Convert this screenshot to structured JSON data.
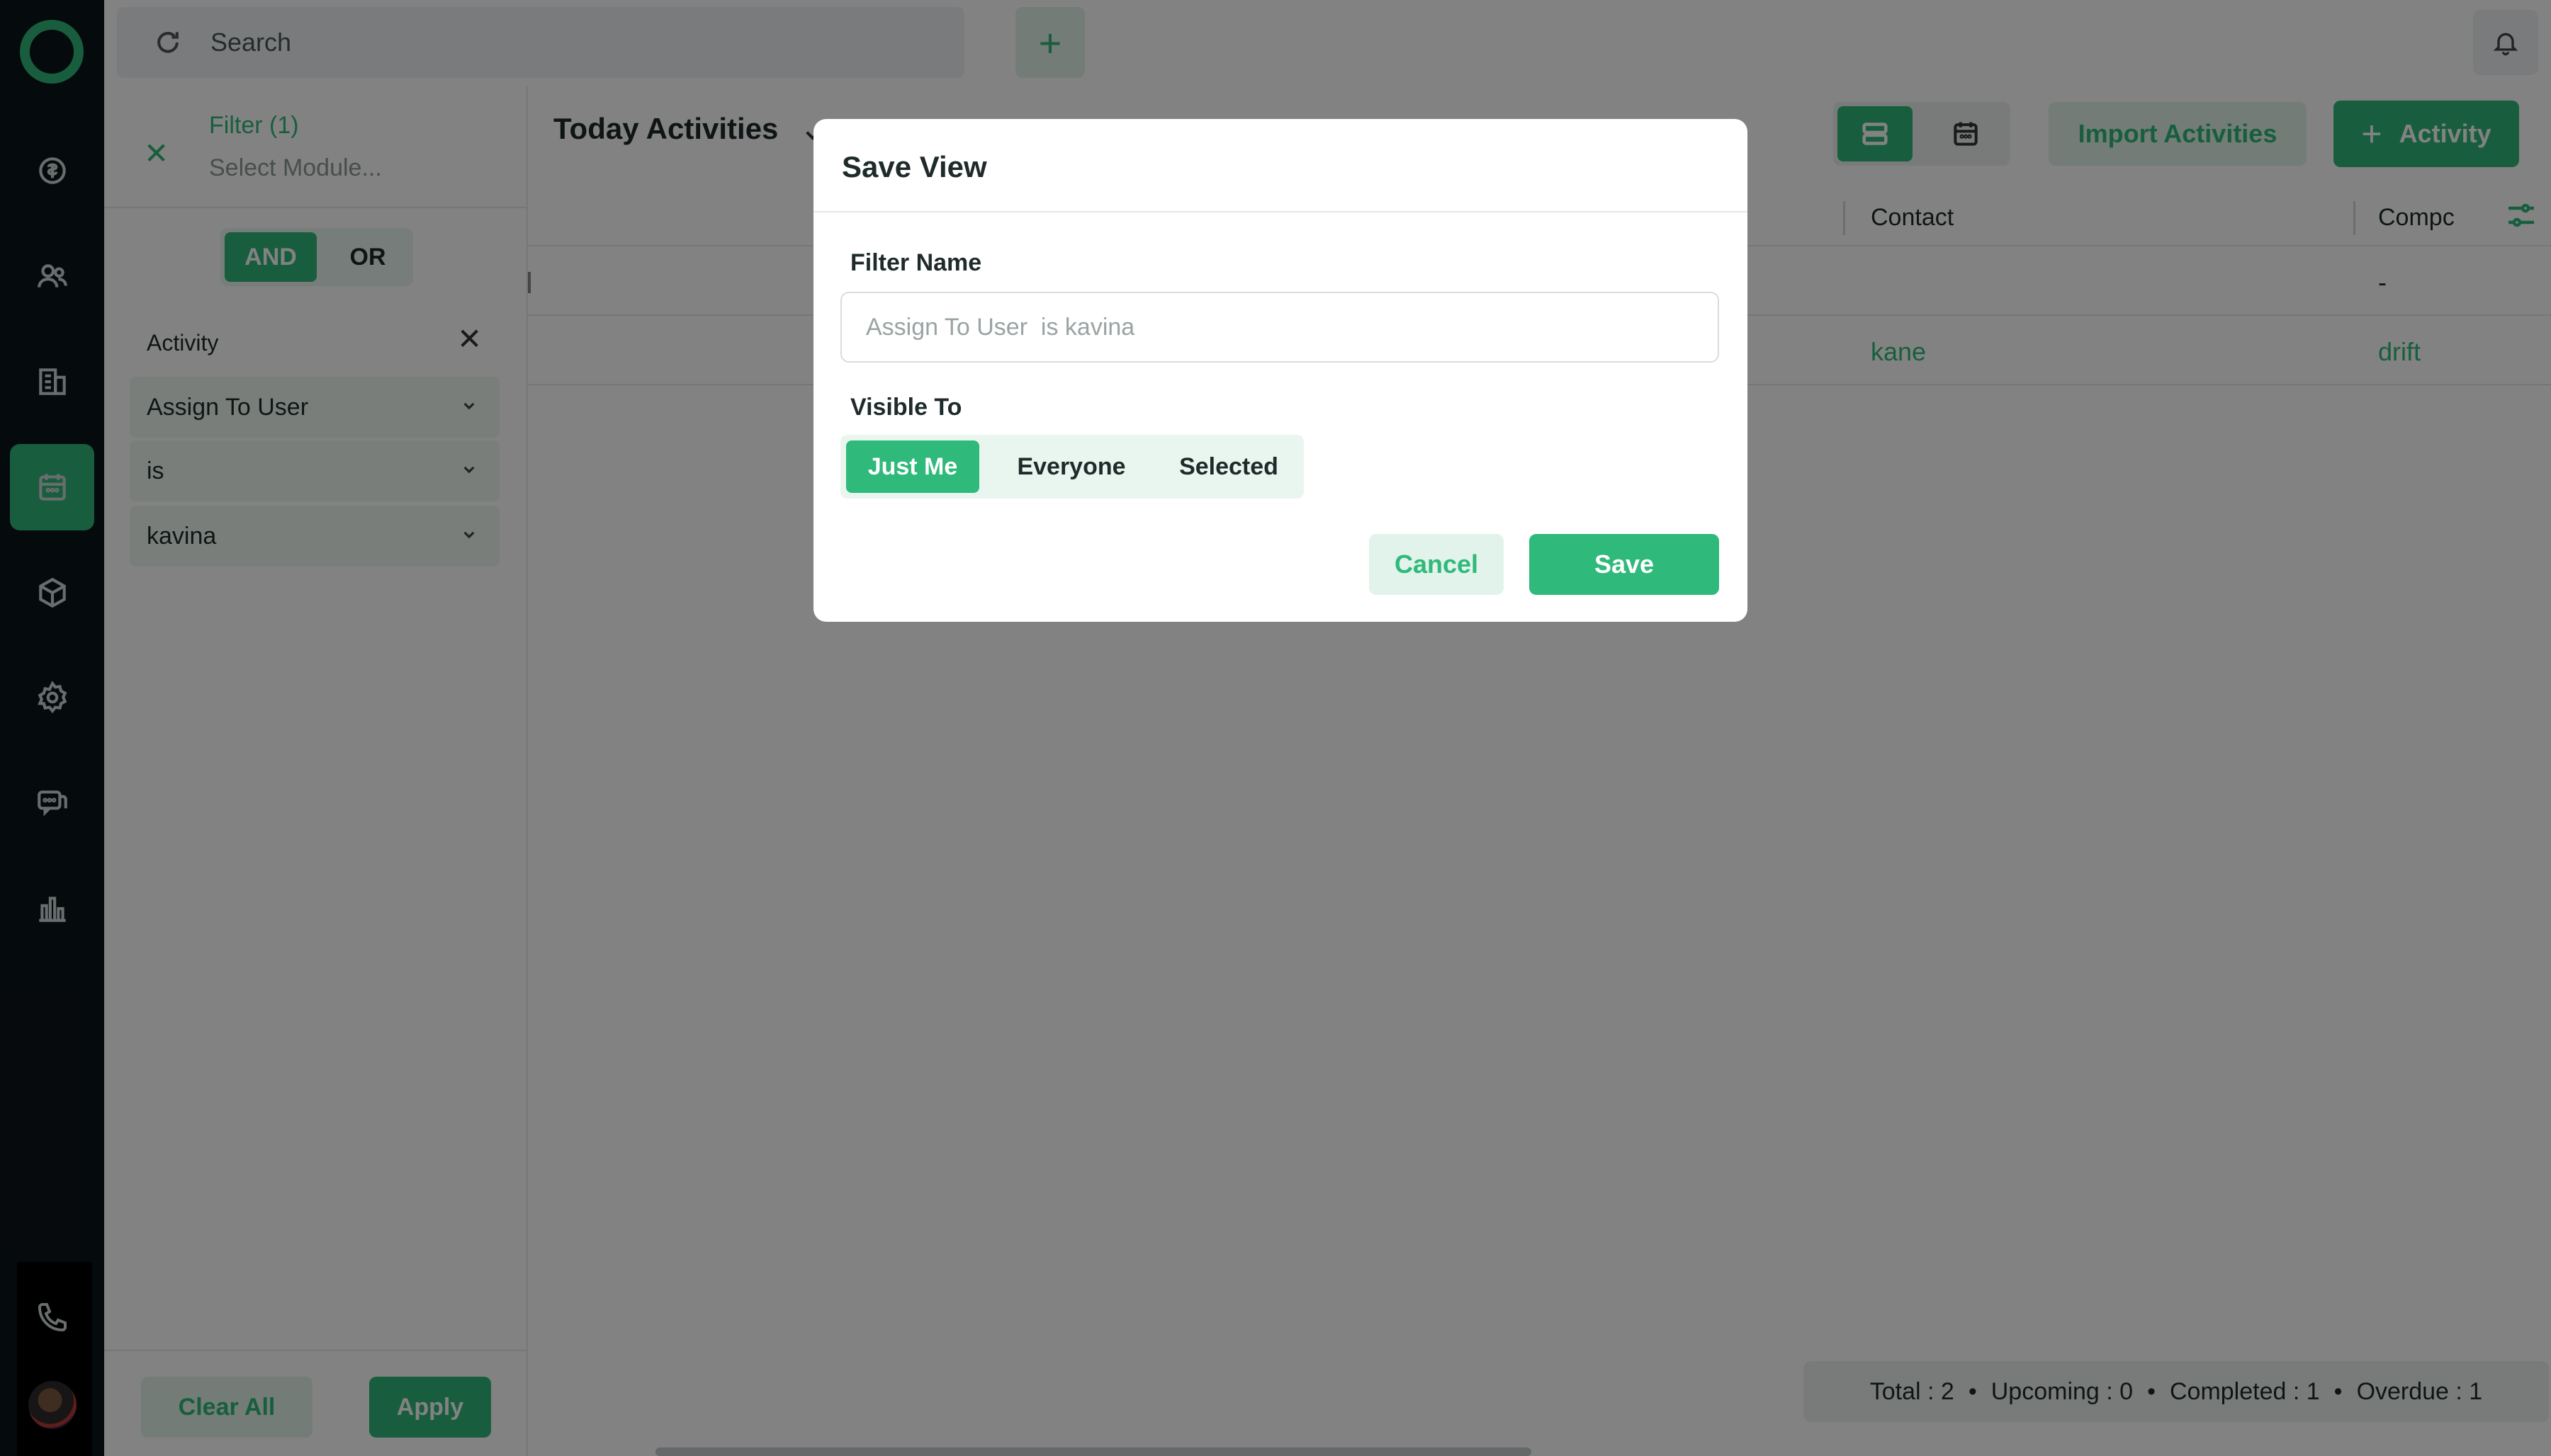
{
  "search": {
    "placeholder": "Search"
  },
  "filter": {
    "title": "Filter (1)",
    "module_placeholder": "Select Module...",
    "and_label": "AND",
    "or_label": "OR",
    "condition_label": "Activity",
    "field": "Assign To User",
    "operator": "is",
    "value": "kavina",
    "clear_label": "Clear All",
    "apply_label": "Apply"
  },
  "main": {
    "view_title": "Today Activities",
    "import_label": "Import Activities",
    "activity_label": "Activity",
    "columns": {
      "contact": "Contact",
      "company": "Compc"
    },
    "rows": [
      {
        "contact": "",
        "company": "-"
      },
      {
        "contact": "kane",
        "company": "drift"
      }
    ],
    "summary": {
      "total": "Total : 2",
      "upcoming": "Upcoming : 0",
      "completed": "Completed : 1",
      "overdue": "Overdue : 1",
      "separator": "•"
    }
  },
  "modal": {
    "title": "Save View",
    "filter_name_label": "Filter Name",
    "filter_name_placeholder": "Assign To User  is kavina",
    "visible_to_label": "Visible To",
    "options": [
      "Just Me",
      "Everyone",
      "Selected"
    ],
    "selected_option": "Just Me",
    "cancel_label": "Cancel",
    "save_label": "Save"
  },
  "colors": {
    "accent": "#2fb97a",
    "accent_light": "#e1f3ea",
    "rail": "#0b1418"
  }
}
